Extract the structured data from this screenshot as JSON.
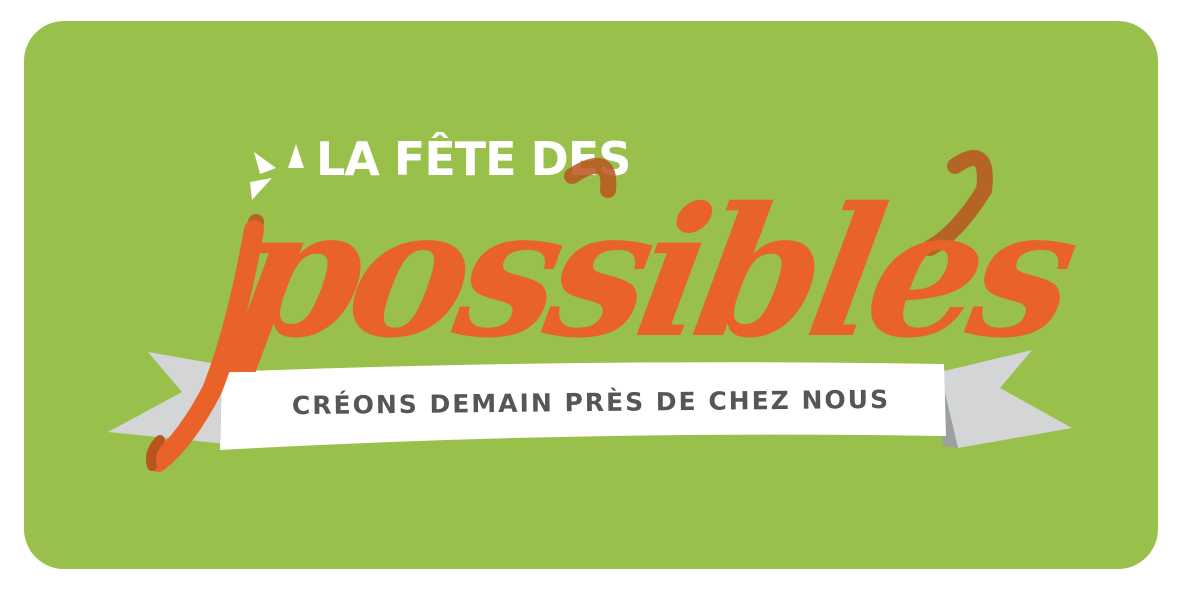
{
  "logo": {
    "top_title": "LA FÊTE DES",
    "script_word": "possibles",
    "tagline": "CRÉONS DEMAIN PRÈS DE CHEZ NOUS",
    "burst_icon": "sparkle-burst-icon"
  },
  "colors": {
    "background_green": "#98c04a",
    "script_orange": "#e8622a",
    "script_shadow": "#b8541f",
    "ribbon_white": "#ffffff",
    "ribbon_grey": "#d4d5d6",
    "ribbon_fold": "#9d9fa2",
    "tagline_text": "#55565a",
    "title_white": "#ffffff"
  }
}
